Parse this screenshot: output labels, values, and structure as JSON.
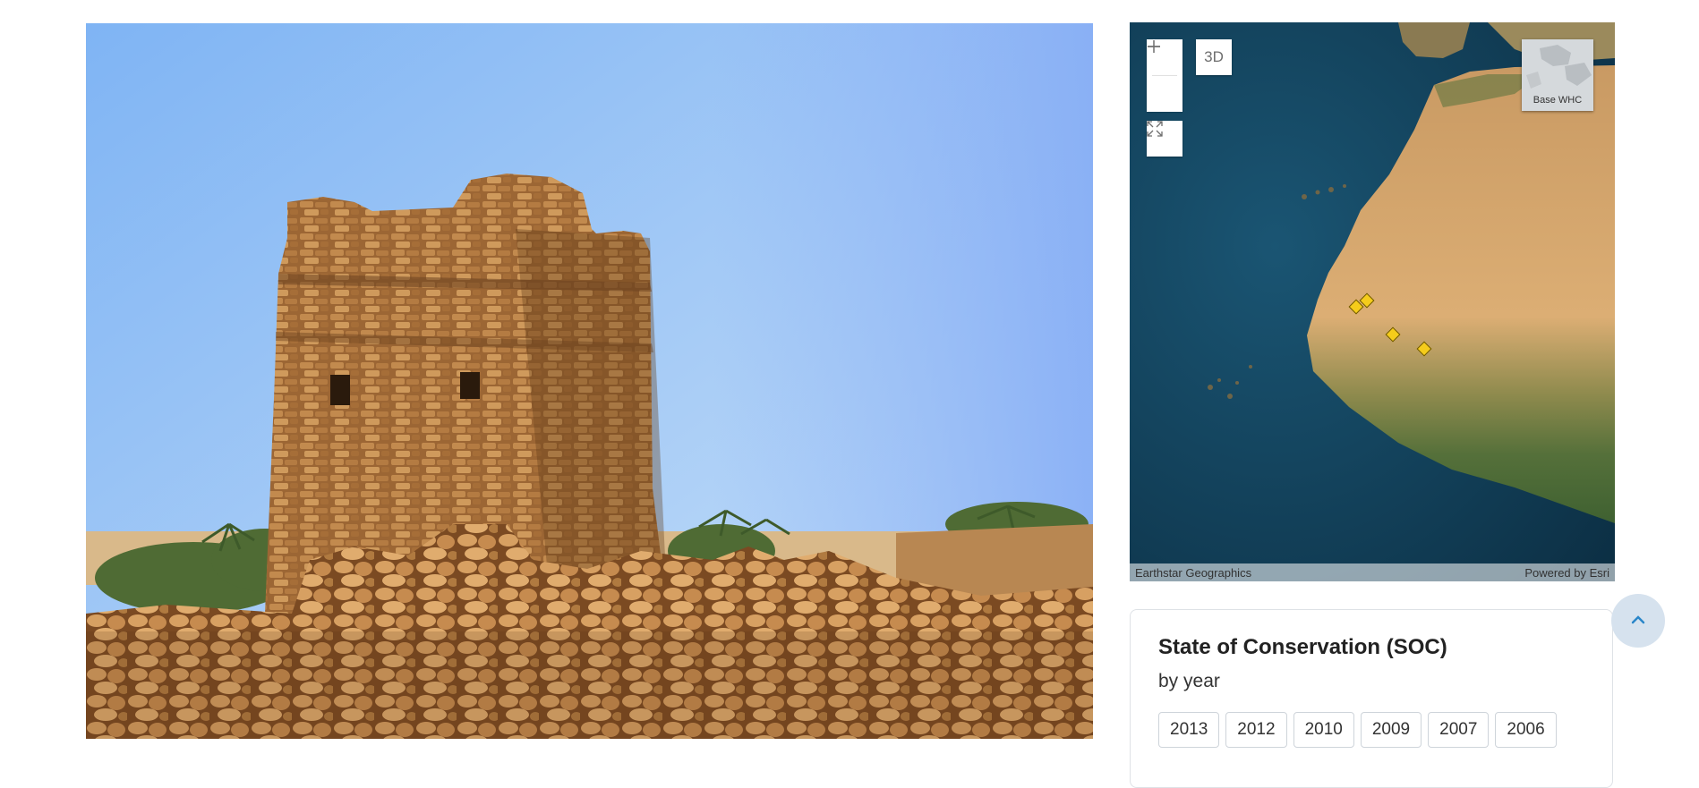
{
  "photo": {
    "subject": "stone-tower-ruins"
  },
  "map": {
    "zoom_in_icon": "plus-icon",
    "zoom_out_icon": "minus-icon",
    "view_3d_label": "3D",
    "expand_icon": "expand-icon",
    "basemap_label": "Base WHC",
    "attribution_left": "Earthstar Geographics",
    "attribution_right": "Powered by Esri",
    "marker_color": "#f5cc1b"
  },
  "soc": {
    "title": "State of Conservation (SOC)",
    "subtitle": "by year",
    "years": [
      "2013",
      "2012",
      "2010",
      "2009",
      "2007",
      "2006"
    ]
  },
  "back_to_top": {
    "icon": "chevron-up-icon"
  }
}
